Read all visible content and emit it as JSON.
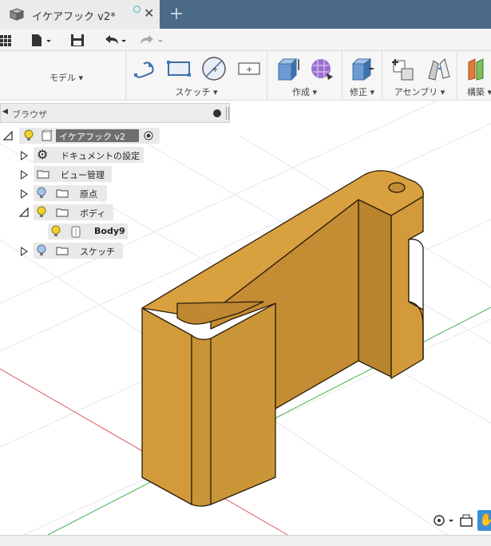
{
  "tab": {
    "title": "イケアフック v2*",
    "close": "✕",
    "new_tab": "+"
  },
  "ribbon": {
    "workspace": "モデル ▾",
    "groups": [
      {
        "label": "スケッチ ▾"
      },
      {
        "label": "作成 ▾"
      },
      {
        "label": "修正 ▾"
      },
      {
        "label": "アセンブリ ▾"
      },
      {
        "label": "構築 ▾"
      }
    ]
  },
  "browser": {
    "title": "ブラウザ",
    "root": "イケアフック v2",
    "items": [
      {
        "label": "ドキュメントの設定"
      },
      {
        "label": "ビュー管理"
      },
      {
        "label": "原点"
      },
      {
        "label": "ボディ"
      },
      {
        "label": "Body9"
      },
      {
        "label": "スケッチ"
      }
    ]
  },
  "colors": {
    "tabbar": "#4b6a87",
    "model": "#d9a03f",
    "accent": "#3b7bbf"
  }
}
